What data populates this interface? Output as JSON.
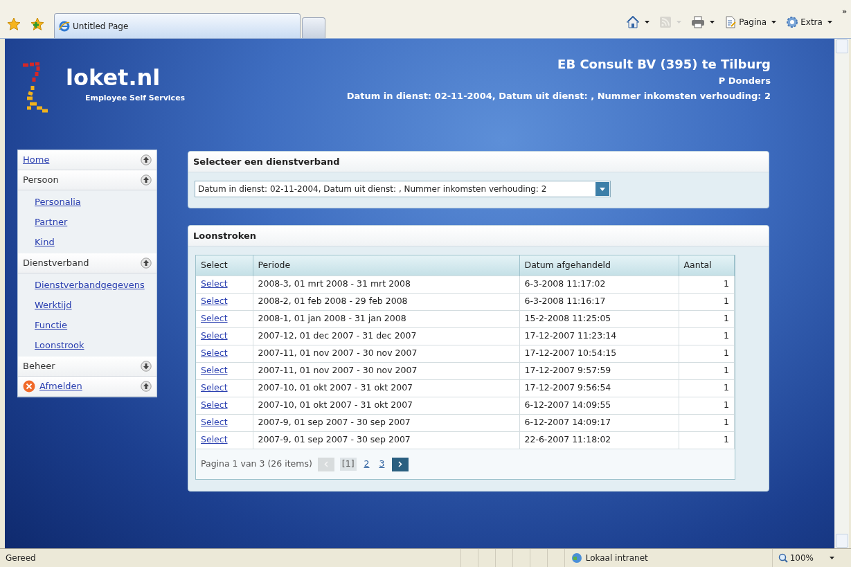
{
  "browser": {
    "tab_title": "Untitled Page",
    "toolbar": [
      {
        "kind": "home",
        "disabled": false
      },
      {
        "kind": "feed",
        "disabled": true
      },
      {
        "kind": "print",
        "disabled": false
      },
      {
        "kind": "page",
        "label": "Pagina",
        "disabled": false
      },
      {
        "kind": "tools",
        "label": "Extra",
        "disabled": false
      }
    ],
    "overflow": "»"
  },
  "header": {
    "logo_text": "loket.nl",
    "logo_subtitle": "Employee Self Services",
    "company": "EB Consult BV (395) te Tilburg",
    "employee": "P Donders",
    "employment": "Datum in dienst: 02-11-2004, Datum uit dienst: , Nummer inkomsten verhouding: 2"
  },
  "sidebar": {
    "items": [
      {
        "label": "Home",
        "kind": "link",
        "expanded": true
      },
      {
        "label": "Persoon",
        "kind": "group",
        "expanded": true,
        "children": [
          {
            "label": "Personalia"
          },
          {
            "label": "Partner"
          },
          {
            "label": "Kind"
          }
        ]
      },
      {
        "label": "Dienstverband",
        "kind": "group",
        "expanded": true,
        "children": [
          {
            "label": "Dienstverbandgegevens"
          },
          {
            "label": "Werktijd"
          },
          {
            "label": "Functie"
          },
          {
            "label": "Loonstrook"
          }
        ]
      },
      {
        "label": "Beheer",
        "kind": "group",
        "expanded": false
      },
      {
        "label": "Afmelden",
        "kind": "logout",
        "expanded": true
      }
    ]
  },
  "select_panel": {
    "title": "Selecteer een dienstverband",
    "value": "Datum in dienst: 02-11-2004, Datum uit dienst: , Nummer inkomsten verhouding: 2"
  },
  "payslips": {
    "title": "Loonstroken",
    "columns": [
      "Select",
      "Periode",
      "Datum afgehandeld",
      "Aantal"
    ],
    "rows": [
      [
        "Select",
        "2008-3, 01 mrt 2008 - 31 mrt 2008",
        "6-3-2008 11:17:02",
        "1"
      ],
      [
        "Select",
        "2008-2, 01 feb 2008 - 29 feb 2008",
        "6-3-2008 11:16:17",
        "1"
      ],
      [
        "Select",
        "2008-1, 01 jan 2008 - 31 jan 2008",
        "15-2-2008 11:25:05",
        "1"
      ],
      [
        "Select",
        "2007-12, 01 dec 2007 - 31 dec 2007",
        "17-12-2007 11:23:14",
        "1"
      ],
      [
        "Select",
        "2007-11, 01 nov 2007 - 30 nov 2007",
        "17-12-2007 10:54:15",
        "1"
      ],
      [
        "Select",
        "2007-11, 01 nov 2007 - 30 nov 2007",
        "17-12-2007 9:57:59",
        "1"
      ],
      [
        "Select",
        "2007-10, 01 okt 2007 - 31 okt 2007",
        "17-12-2007 9:56:54",
        "1"
      ],
      [
        "Select",
        "2007-10, 01 okt 2007 - 31 okt 2007",
        "6-12-2007 14:09:55",
        "1"
      ],
      [
        "Select",
        "2007-9, 01 sep 2007 - 30 sep 2007",
        "6-12-2007 14:09:17",
        "1"
      ],
      [
        "Select",
        "2007-9, 01 sep 2007 - 30 sep 2007",
        "22-6-2007 11:18:02",
        "1"
      ]
    ],
    "pager": {
      "summary": "Pagina 1 van 3 (26 items)",
      "prev_disabled": true,
      "pages": [
        {
          "label": "[1]",
          "selected": true
        },
        {
          "label": "2",
          "selected": false
        },
        {
          "label": "3",
          "selected": false
        }
      ],
      "next_disabled": false
    }
  },
  "status_bar": {
    "text": "Gereed",
    "zone": "Lokaal intranet",
    "zoom": "100%"
  }
}
